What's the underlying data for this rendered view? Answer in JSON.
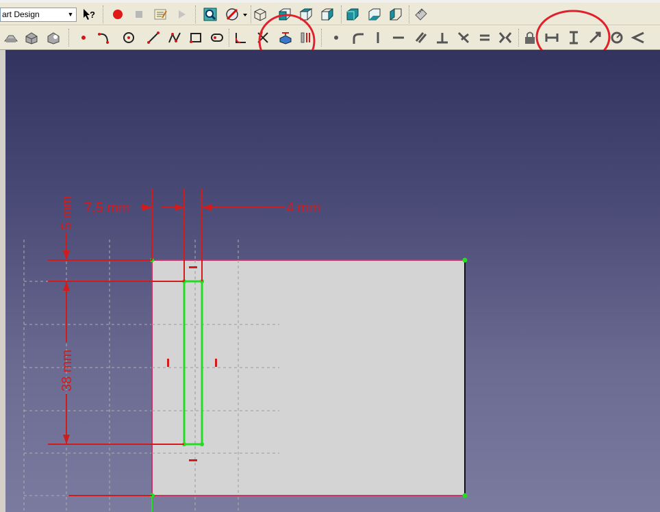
{
  "toolbar_top": {
    "workbench_selector": {
      "value": "art Design"
    }
  },
  "icons_row1": [
    "whats-this-icon",
    "record-macro-icon",
    "stop-macro-icon",
    "edit-macro-icon",
    "run-macro-icon",
    "fit-all-icon",
    "draw-style-icon",
    "view-axonometric-icon",
    "view-front-icon",
    "view-top-icon",
    "view-right-icon",
    "view-rear-icon",
    "view-bottom-icon",
    "view-left-icon",
    "measure-icon"
  ],
  "icons_row2": [
    "create-sketch-icon",
    "map-sketch-icon",
    "view-sketch-icon",
    "point-icon",
    "arc-icon",
    "circle-icon",
    "line-icon",
    "polyline-icon",
    "rectangle-icon",
    "slot-icon",
    "fillet-icon",
    "trim-icon",
    "external-geometry-icon",
    "carbon-copy-icon",
    "coincident-icon",
    "point-on-object-icon",
    "vertical-icon",
    "horizontal-icon",
    "parallel-icon",
    "perpendicular-icon",
    "tangent-icon",
    "equal-icon",
    "symmetric-icon",
    "lock-icon",
    "horizontal-distance-icon",
    "vertical-distance-icon",
    "length-icon",
    "radius-icon",
    "angle-icon"
  ],
  "annotations": {
    "circle_1_around": "external-geometry-icon",
    "circle_2_around": "distance-constraints-group",
    "color": "#e0202a"
  },
  "sketch": {
    "dimensions": {
      "offset_x": "7,5 mm",
      "slot_width": "4 mm",
      "offset_y": "5 mm",
      "slot_height": "38 mm"
    },
    "colors": {
      "dimension": "#d21c1c",
      "constraint_geometry": "#22dd22",
      "face": "#d4d4d4",
      "face_edge": "#cc3366",
      "grid": "#a0a0a0"
    }
  }
}
